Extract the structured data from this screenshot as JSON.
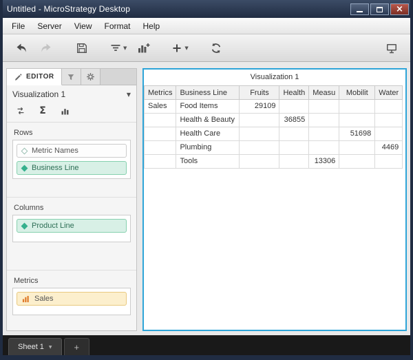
{
  "window": {
    "title": "Untitled - MicroStrategy Desktop"
  },
  "menu": {
    "items": [
      "File",
      "Server",
      "View",
      "Format",
      "Help"
    ]
  },
  "toolbar": {
    "icons": [
      "back",
      "forward",
      "save",
      "datasets",
      "insert-visualization",
      "insert",
      "refresh",
      "presentation"
    ]
  },
  "editor": {
    "tab_label": "EDITOR",
    "visualization_selector": "Visualization 1",
    "sections": {
      "rows": {
        "label": "Rows",
        "items": [
          {
            "label": "Metric Names"
          },
          {
            "label": "Business Line"
          }
        ]
      },
      "columns": {
        "label": "Columns",
        "items": [
          {
            "label": "Product Line"
          }
        ]
      },
      "metrics": {
        "label": "Metrics",
        "items": [
          {
            "label": "Sales"
          }
        ]
      }
    }
  },
  "viz": {
    "title": "Visualization 1"
  },
  "grid": {
    "columns": [
      "Metrics",
      "Business Line",
      "Fruits",
      "Health",
      "Measu",
      "Mobilit",
      "Water"
    ],
    "rows": [
      {
        "metric": "Sales",
        "business_line": "Food Items",
        "values": [
          "29109",
          "",
          "",
          "",
          ""
        ]
      },
      {
        "metric": "",
        "business_line": "Health & Beauty",
        "values": [
          "",
          "36855",
          "",
          "",
          ""
        ]
      },
      {
        "metric": "",
        "business_line": "Health Care",
        "values": [
          "",
          "",
          "",
          "51698",
          ""
        ]
      },
      {
        "metric": "",
        "business_line": "Plumbing",
        "values": [
          "",
          "",
          "",
          "",
          "4469"
        ]
      },
      {
        "metric": "",
        "business_line": "Tools",
        "values": [
          "",
          "",
          "13306",
          "",
          ""
        ]
      }
    ]
  },
  "sheetbar": {
    "tab": "Sheet 1",
    "add": "+"
  },
  "icons": {
    "sigma": "Σ",
    "caret": "▼",
    "close": "×"
  },
  "colors": {
    "titlebar": "#202c42",
    "selection_border": "#2da4d8",
    "attribute_green_bg": "#d8f0e6",
    "attribute_green_border": "#86d0ae",
    "metric_orange_bg": "#fcefcd",
    "metric_orange_border": "#e9c97f",
    "diamond_teal": "#35b08d"
  }
}
